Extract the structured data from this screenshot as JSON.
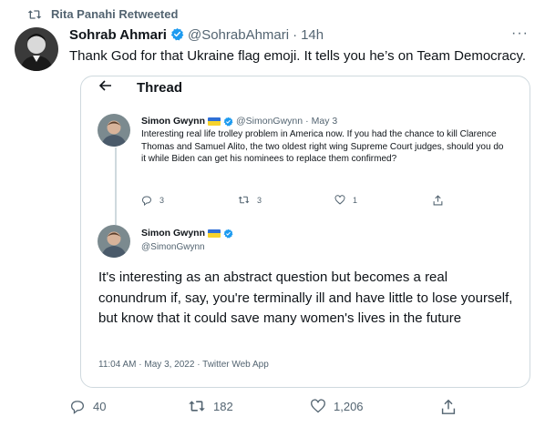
{
  "retweet": {
    "label": "Rita Panahi Retweeted",
    "icon": "retweet-icon"
  },
  "tweet": {
    "author_name": "Sohrab Ahmari",
    "author_handle": "@SohrabAhmari",
    "separator": "·",
    "time": "14h",
    "text": "Thank God for that Ukraine flag emoji. It tells you he’s on Team Democracy.",
    "more_label": "···",
    "actions": {
      "replies": "40",
      "retweets": "182",
      "likes": "1,206"
    }
  },
  "quote": {
    "thread_title": "Thread",
    "first": {
      "author_name": "Simon Gwynn",
      "author_handle": "@SimonGwynn",
      "separator": "·",
      "date": "May 3",
      "text": "Interesting real life trolley problem in America now. If you had the chance to kill Clarence Thomas and Samuel Alito, the two oldest right wing Supreme Court judges, should you do it while Biden can get his nominees to replace them confirmed?",
      "actions": {
        "replies": "3",
        "retweets": "3",
        "likes": "1"
      }
    },
    "second": {
      "author_name": "Simon Gwynn",
      "author_handle": "@SimonGwynn",
      "text": "It's interesting as an abstract question but becomes a real conundrum if, say, you're terminally ill and have little to lose yourself, but know that it could save many women's lives in the future",
      "meta": "11:04 AM · May 3, 2022 · Twitter Web App"
    }
  },
  "colors": {
    "verified": "#1d9bf0",
    "text": "#0f1419",
    "muted": "#536471",
    "border": "#cfd9de",
    "flag_blue": "#2f6fd6",
    "flag_yellow": "#f6d32d"
  }
}
